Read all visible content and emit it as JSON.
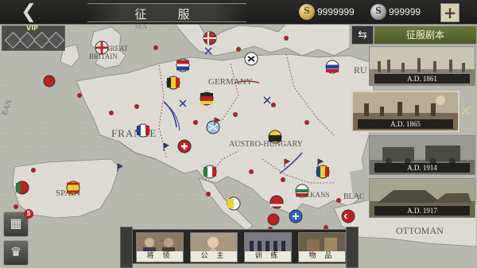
{
  "header": {
    "back_icon": "back-arrow-icon",
    "title": "征　服",
    "gold_symbol": "S",
    "gold_amount": "9999999",
    "silver_symbol": "S",
    "silver_amount": "999999",
    "plus_label": "+"
  },
  "vip": {
    "label": "VIP"
  },
  "scenarios": {
    "header": "征服剧本",
    "swap_icon": "⇆",
    "cards": [
      {
        "date": "A.D. 1861"
      },
      {
        "date": "A.D. 1865"
      },
      {
        "date": "A.D. 1914"
      },
      {
        "date": "A.D. 1917"
      }
    ]
  },
  "map_labels": {
    "britain_1": "GREAT",
    "britain_2": "BRITAIN",
    "france": "FRANCE",
    "germany": "GERMANY",
    "austro": "AUSTRO-HUNGARY",
    "spain": "SPAIN",
    "balkans": "BALKANS",
    "ottoman": "OTTOMAN",
    "ru": "RU",
    "black": "BLAC",
    "sea": "SEA",
    "ean": "EAN"
  },
  "bottom_menu": [
    {
      "label": "将 领"
    },
    {
      "label": "公 主"
    },
    {
      "label": "训 练"
    },
    {
      "label": "物 品"
    }
  ],
  "side": {
    "badge_count": "5",
    "film_icon": "film-icon",
    "trophy_icon": "trophy-icon"
  },
  "colors": {
    "sea": "#b9bcb2",
    "land": "#dcdad2",
    "border": "#9a5a70",
    "accent_green": "#5b6a2e"
  }
}
